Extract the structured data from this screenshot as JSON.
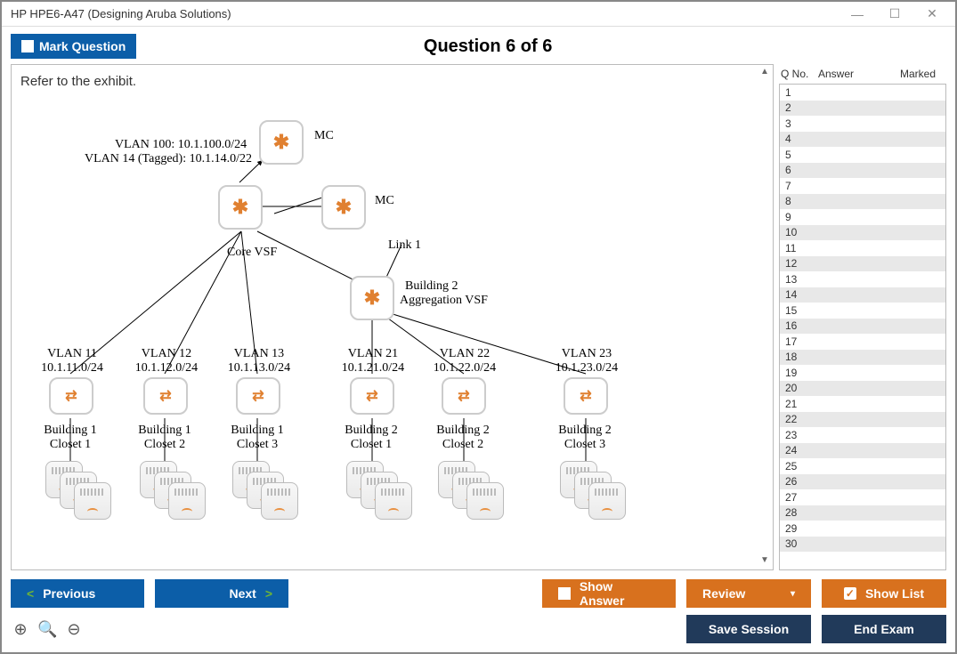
{
  "window_title": "HP HPE6-A47 (Designing Aruba Solutions)",
  "mark_button": "Mark Question",
  "question_header": "Question 6 of 6",
  "question_text": "Refer to the exhibit.",
  "exhibit": {
    "vlan100": "VLAN 100: 10.1.100.0/24",
    "vlan14": "VLAN 14 (Tagged): 10.1.14.0/22",
    "mc1": "MC",
    "mc2": "MC",
    "core": "Core VSF",
    "link1": "Link 1",
    "bldg2agg": "Building 2\nAggregation VSF",
    "vlans": [
      {
        "name": "VLAN 11",
        "subnet": "10.1.11.0/24",
        "bldg": "Building 1",
        "closet": "Closet 1"
      },
      {
        "name": "VLAN 12",
        "subnet": "10.1.12.0/24",
        "bldg": "Building 1",
        "closet": "Closet 2"
      },
      {
        "name": "VLAN 13",
        "subnet": "10.1.13.0/24",
        "bldg": "Building 1",
        "closet": "Closet 3"
      },
      {
        "name": "VLAN 21",
        "subnet": "10.1.21.0/24",
        "bldg": "Building 2",
        "closet": "Closet 1"
      },
      {
        "name": "VLAN 22",
        "subnet": "10.1.22.0/24",
        "bldg": "Building 2",
        "closet": "Closet 2"
      },
      {
        "name": "VLAN 23",
        "subnet": "10.1.23.0/24",
        "bldg": "Building 2",
        "closet": "Closet 3"
      }
    ]
  },
  "sidebar": {
    "header_qno": "Q No.",
    "header_answer": "Answer",
    "header_marked": "Marked",
    "rows": [
      1,
      2,
      3,
      4,
      5,
      6,
      7,
      8,
      9,
      10,
      11,
      12,
      13,
      14,
      15,
      16,
      17,
      18,
      19,
      20,
      21,
      22,
      23,
      24,
      25,
      26,
      27,
      28,
      29,
      30
    ]
  },
  "buttons": {
    "previous": "Previous",
    "next": "Next",
    "show_answer": "Show Answer",
    "review": "Review",
    "show_list": "Show List",
    "save_session": "Save Session",
    "end_exam": "End Exam"
  }
}
